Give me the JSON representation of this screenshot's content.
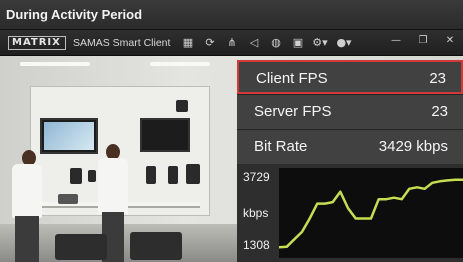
{
  "window": {
    "title": "During Activity Period"
  },
  "app": {
    "logo_text": "MATRIX",
    "name": "SAMAS Smart Client",
    "toolbar_icons": [
      "layout-icon",
      "refresh-icon",
      "network-icon",
      "bell-icon",
      "globe-icon",
      "lock-icon",
      "settings-icon",
      "user-icon"
    ],
    "window_buttons": {
      "minimize": "—",
      "restore": "❐",
      "close": "✕"
    }
  },
  "stats": [
    {
      "label": "Client FPS",
      "value": "23",
      "highlighted": true
    },
    {
      "label": "Server FPS",
      "value": "23",
      "highlighted": false
    },
    {
      "label": "Bit Rate",
      "value": "3429 kbps",
      "highlighted": false
    }
  ],
  "graph": {
    "y_max_label": "3729",
    "y_unit_label": "kbps",
    "y_min_label": "1308",
    "line_color": "#c6dd52",
    "highlight_color": "#d23a3a"
  },
  "chart_data": {
    "type": "line",
    "ylim": [
      1308,
      3729
    ],
    "ylabel": "kbps",
    "x": [
      0,
      1,
      2,
      3,
      4,
      5,
      6,
      7,
      8,
      9,
      10,
      11,
      12,
      13,
      14,
      15,
      16,
      17,
      18,
      19,
      20,
      21,
      22,
      23,
      24
    ],
    "values": [
      1330,
      1350,
      1600,
      1850,
      2300,
      2800,
      2800,
      2850,
      3200,
      2650,
      2300,
      2300,
      2300,
      2950,
      2950,
      3000,
      2950,
      3300,
      3350,
      3300,
      3500,
      3550,
      3580,
      3600,
      3600
    ]
  }
}
